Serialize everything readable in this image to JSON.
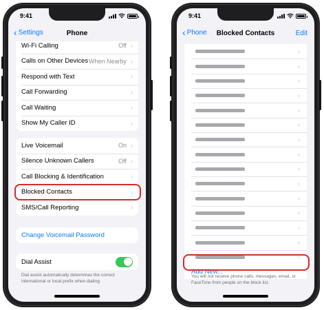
{
  "status_bar": {
    "time": "9:41"
  },
  "left_screen": {
    "nav": {
      "back_label": "Settings",
      "title": "Phone"
    },
    "group1": [
      {
        "label": "Wi-Fi Calling",
        "value": "Off"
      },
      {
        "label": "Calls on Other Devices",
        "value": "When Nearby"
      },
      {
        "label": "Respond with Text",
        "value": ""
      },
      {
        "label": "Call Forwarding",
        "value": ""
      },
      {
        "label": "Call Waiting",
        "value": ""
      },
      {
        "label": "Show My Caller ID",
        "value": ""
      }
    ],
    "group2": [
      {
        "label": "Live Voicemail",
        "value": "On"
      },
      {
        "label": "Silence Unknown Callers",
        "value": "Off"
      },
      {
        "label": "Call Blocking & Identification",
        "value": ""
      },
      {
        "label": "Blocked Contacts",
        "value": ""
      },
      {
        "label": "SMS/Call Reporting",
        "value": ""
      }
    ],
    "voicemail_password_label": "Change Voicemail Password",
    "dial_assist": {
      "label": "Dial Assist",
      "enabled": true,
      "footnote": "Dial assist automatically determines the correct international or local prefix when dialing."
    },
    "toggle_on_color": "#34c759"
  },
  "right_screen": {
    "nav": {
      "back_label": "Phone",
      "title": "Blocked Contacts",
      "edit_label": "Edit"
    },
    "blocked_contact_count": 15,
    "add_new_label": "Add New...",
    "footnote": "You will not receive phone calls, messages, email, or FaceTime from people on the block list."
  },
  "colors": {
    "accent": "#0a7aff",
    "highlight": "#d62b2b",
    "background": "#f2f2f7"
  },
  "icons": {
    "chevron": "›",
    "back_chevron": "‹"
  }
}
